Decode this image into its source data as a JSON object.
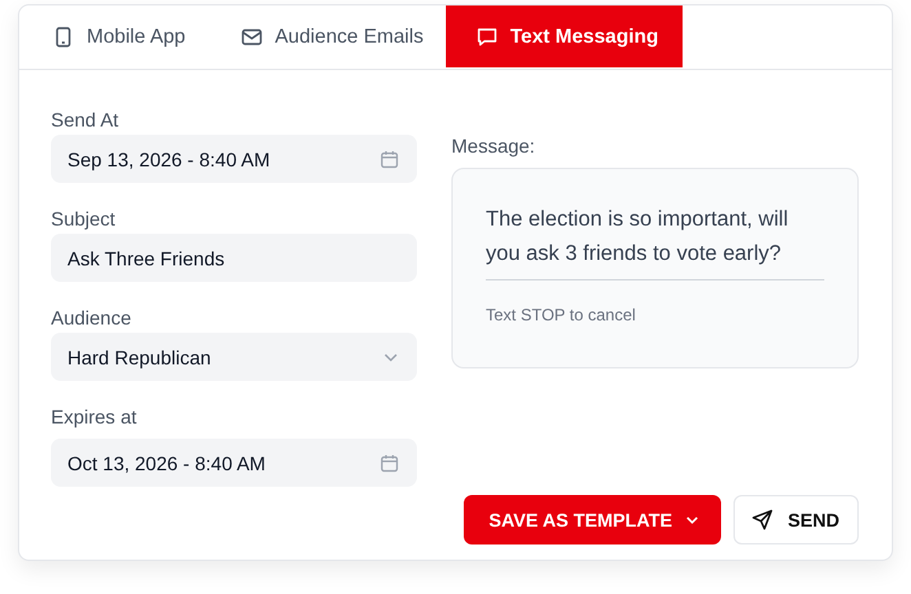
{
  "tabs": [
    {
      "label": "Mobile App",
      "kind": "mobile",
      "selected": false
    },
    {
      "label": "Audience Emails",
      "kind": "email",
      "selected": false
    },
    {
      "label": "Text Messaging",
      "kind": "sms",
      "selected": true
    }
  ],
  "fields": [
    {
      "label": "Send At",
      "kind": "date",
      "value": "Sep 13, 2026 - 8:40 AM"
    },
    {
      "label": "Subject",
      "kind": "text",
      "value": "Ask Three Friends"
    },
    {
      "label": "Audience",
      "kind": "select",
      "value": "Hard Republican"
    },
    {
      "label": "Expires at",
      "kind": "date",
      "value": "Oct 13, 2026 - 8:40 AM"
    }
  ],
  "message": {
    "label": "Message:",
    "body": "The election is so important, will you ask 3 friends to vote early?",
    "footer": "Text STOP to cancel"
  },
  "buttons": [
    {
      "label": "SAVE AS TEMPLATE",
      "kind": "primary"
    },
    {
      "label": "SEND",
      "kind": "secondary"
    }
  ]
}
